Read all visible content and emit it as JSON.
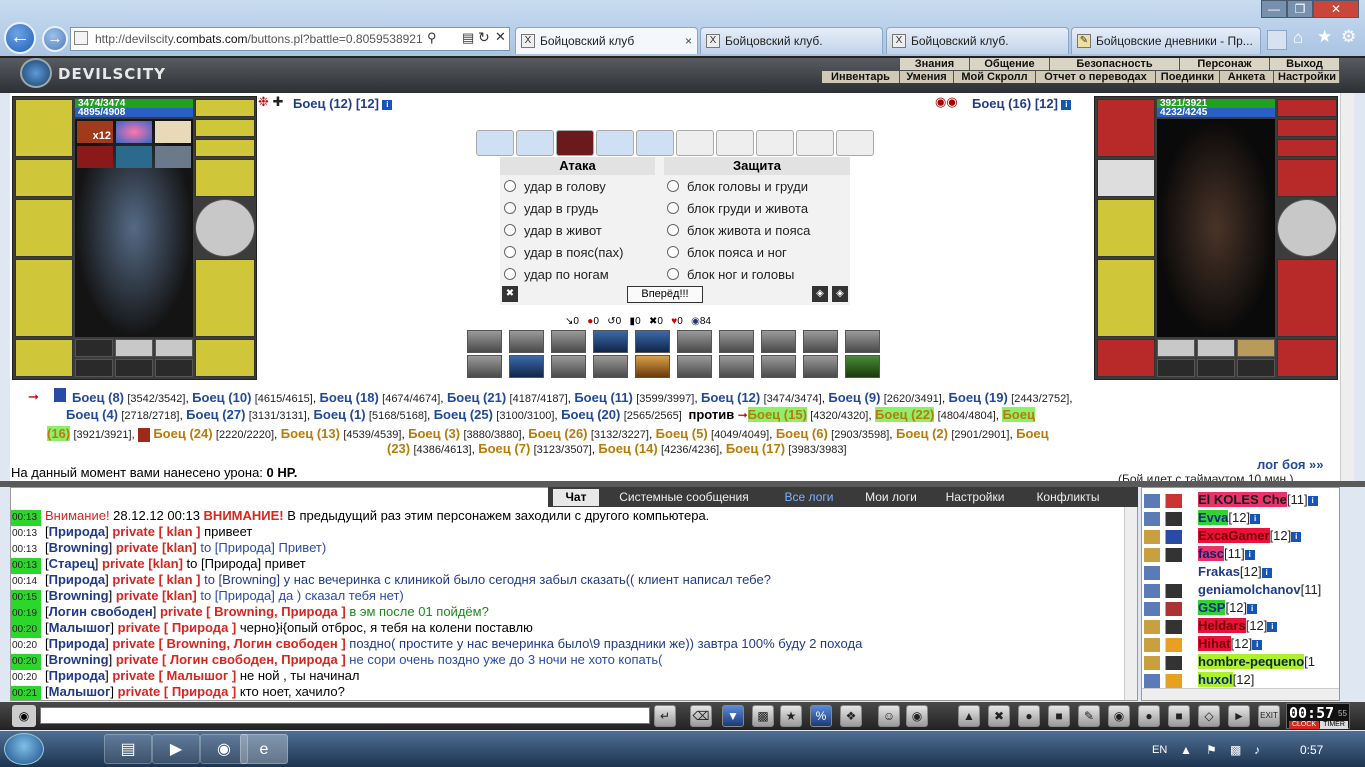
{
  "browser": {
    "url_prefix": "http://devilscity.",
    "url_domain": "combats.com",
    "url_rest": "/buttons.pl?battle=0.8059538921",
    "tabs": [
      "Бойцовский клуб",
      "Бойцовский клуб.",
      "Бойцовский клуб.",
      "Бойцовские дневники - Пр..."
    ]
  },
  "game": {
    "logo": "DEVILSCITY",
    "menu_top": [
      "Знания",
      "Общение",
      "Безопасность",
      "Персонаж",
      "Выход"
    ],
    "menu_bottom": [
      "Инвентарь",
      "Умения",
      "Мой Скролл",
      "Отчет о переводах",
      "Поединки",
      "Анкета",
      "Настройки"
    ]
  },
  "left_fighter": {
    "name": "Боец (12) [12]",
    "hp": "3474/3474",
    "mana": "4895/4908",
    "count_badge": "x12"
  },
  "right_fighter": {
    "name": "Боец (16) [12]",
    "hp": "3921/3921",
    "mana": "4232/4245"
  },
  "attack": {
    "title": "Атака",
    "options": [
      "удар в голову",
      "удар в грудь",
      "удар в живот",
      "удар в пояс(пах)",
      "удар по ногам"
    ]
  },
  "defense": {
    "title": "Защита",
    "options": [
      "блок головы и груди",
      "блок груди и живота",
      "блок живота и пояса",
      "блок пояса и ног",
      "блок ног и головы"
    ]
  },
  "forward_button": "Вперёд!!!",
  "stats": [
    "0",
    "0",
    "0",
    "0",
    "0",
    "0",
    "84"
  ],
  "teams": {
    "line1": [
      [
        "Боец (8)",
        "[3542/3542]"
      ],
      [
        "Боец (10)",
        "[4615/4615]"
      ],
      [
        "Боец (18)",
        "[4674/4674]"
      ],
      [
        "Боец (21)",
        "[4187/4187]"
      ],
      [
        "Боец (11)",
        "[3599/3997]"
      ],
      [
        "Боец (12)",
        "[3474/3474]"
      ],
      [
        "Боец (9)",
        "[2620/3491]"
      ],
      [
        "Боец (19)",
        "[2443/2752]"
      ]
    ],
    "line2": [
      [
        "Боец (4)",
        "[2718/2718]"
      ],
      [
        "Боец (27)",
        "[3131/3131]"
      ],
      [
        "Боец (1)",
        "[5168/5168]"
      ],
      [
        "Боец (25)",
        "[3100/3100]"
      ],
      [
        "Боец (20)",
        "[2565/2565]"
      ]
    ],
    "versus": "против",
    "line2b": [
      [
        "Боец (15)",
        "[4320/4320]"
      ],
      [
        "Боец (22)",
        "[4804/4804]"
      ],
      [
        "Боец",
        "(16)"
      ]
    ],
    "line3": [
      [
        "(16)",
        "[3921/3921],"
      ],
      [
        "Боец (24)",
        "[2220/2220]"
      ],
      [
        "Боец (13)",
        "[4539/4539]"
      ],
      [
        "Боец (3)",
        "[3880/3880]"
      ],
      [
        "Боец (26)",
        "[3132/3227]"
      ],
      [
        "Боец (5)",
        "[4049/4049]"
      ],
      [
        "Боец (6)",
        "[2903/3598]"
      ],
      [
        "Боец (2)",
        "[2901/2901]"
      ],
      [
        "Боец",
        "(23)"
      ]
    ],
    "line4": [
      [
        "(23)",
        "[4386/4613]"
      ],
      [
        "Боец (7)",
        "[3123/3507]"
      ],
      [
        "Боец (14)",
        "[4236/4236]"
      ],
      [
        "Боец (17)",
        "[3983/3983]"
      ]
    ]
  },
  "damage_text": "На данный момент вами нанесено урона: ",
  "damage_value": "0 HP.",
  "log_link": "лог боя »»",
  "timeout_text": "(Бой идет с таймаутом 10 мин.)",
  "chat_tabs": [
    "Чат",
    "Системные сообщения",
    "Все логи",
    "Мои логи",
    "Настройки",
    "Конфликты"
  ],
  "chat": [
    {
      "t": "00:13",
      "g": true,
      "a": "Внимание!",
      "b": " 28.12.12 00:13 ",
      "c": "ВНИМАНИЕ!",
      "d": " В предыдущий раз этим персонажем заходили с другого компьютера."
    },
    {
      "t": "00:13",
      "g": false,
      "nick": "Природа",
      "priv": "private [ klan ]",
      "text": " привеет"
    },
    {
      "t": "00:13",
      "g": false,
      "nick": "Browning",
      "priv": "private [klan]",
      "to": " to [Природа]",
      "text": " Привет)"
    },
    {
      "t": "00:13",
      "g": true,
      "nick": "Старец",
      "priv": "private [klan]",
      "to": " to [Природа]",
      "text": " привет"
    },
    {
      "t": "00:14",
      "g": false,
      "nick": "Природа",
      "priv": "private [ klan ]",
      "to": " to [Browning]",
      "text": " у нас вечеринка с клиникой было сегодня забыл сказать(( клиент написал тебе?"
    },
    {
      "t": "00:15",
      "g": true,
      "nick": "Browning",
      "priv": "private [klan]",
      "to": " to [Природа]",
      "text": " да ) сказал тебя нет)"
    },
    {
      "t": "00:19",
      "g": true,
      "nick": "Логин свободен",
      "priv": "private [ Browning, Природа ]",
      "text": " в эм после 01 пойдём?",
      "green": true
    },
    {
      "t": "00:20",
      "g": true,
      "nick": "Малышог",
      "priv": "private [ Природа ]",
      "text": " черно}i{опый отброс, я тебя на колени поставлю"
    },
    {
      "t": "00:20",
      "g": false,
      "nick": "Природа",
      "priv": "private [ Browning, Логин свободен ]",
      "text": " поздно( простите у нас вечеринка было\\9 праздники же)) завтра 100% буду 2 похода"
    },
    {
      "t": "00:20",
      "g": true,
      "nick": "Browning",
      "priv": "private [ Логин свободен, Природа ]",
      "text": " не сори очень поздно уже до 3 ночи не хото копать(",
      "blue": true
    },
    {
      "t": "00:20",
      "g": false,
      "nick": "Природа",
      "priv": "private [ Малышог ]",
      "text": " не ной , ты начинал"
    },
    {
      "t": "00:21",
      "g": true,
      "nick": "Малышог",
      "priv": "private [ Природа ]",
      "text": " кто ноет, хачило?"
    }
  ],
  "users": [
    {
      "name": "El KOLES Che",
      "lvl": "[11]",
      "bg": "#e8336a",
      "fg": "#1a1a1a"
    },
    {
      "name": "Evva",
      "lvl": "[12]",
      "bg": "#32d232",
      "fg": "#0a2a7a"
    },
    {
      "name": "ExcaGamer",
      "lvl": "[12]",
      "bg": "#e8123a",
      "fg": "#7a0000"
    },
    {
      "name": "fasc",
      "lvl": "[11]",
      "bg": "#e8336a",
      "fg": "#1a1a6a"
    },
    {
      "name": "Frakas",
      "lvl": "[12]",
      "bg": "",
      "fg": "#1f3a8a"
    },
    {
      "name": "geniamolchanov",
      "lvl": "[11]",
      "bg": "",
      "fg": "#1f3a8a"
    },
    {
      "name": "GSP",
      "lvl": "[12]",
      "bg": "#32d232",
      "fg": "#0a2a7a"
    },
    {
      "name": "Heldars",
      "lvl": "[12]",
      "bg": "#e8123a",
      "fg": "#7a0000"
    },
    {
      "name": "Hihat",
      "lvl": "[12]",
      "bg": "#e8123a",
      "fg": "#7a0000"
    },
    {
      "name": "hombre-pequeno",
      "lvl": "[1",
      "bg": "#aef02a",
      "fg": "#0a2a2a"
    },
    {
      "name": "huxol",
      "lvl": "[12]",
      "bg": "#aef02a",
      "fg": "#0a2a7a"
    }
  ],
  "clock": {
    "time": "00:57",
    "sec": "55",
    "labels": [
      "CLOCK",
      "TIMER"
    ]
  },
  "taskbar": {
    "lang": "EN",
    "time": "0:57"
  }
}
